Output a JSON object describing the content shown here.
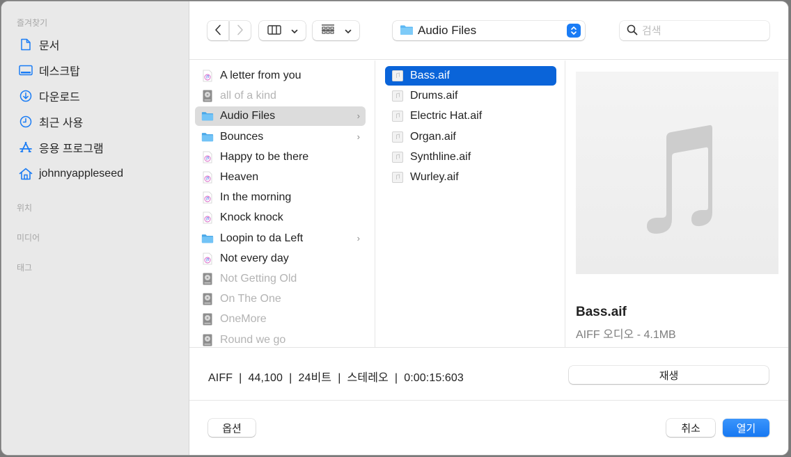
{
  "sidebar": {
    "favorites_label": "즐겨찾기",
    "favorites": [
      {
        "label": "문서",
        "icon": "document-icon"
      },
      {
        "label": "데스크탑",
        "icon": "desktop-icon"
      },
      {
        "label": "다운로드",
        "icon": "download-icon"
      },
      {
        "label": "최근 사용",
        "icon": "clock-icon"
      },
      {
        "label": "응용 프로그램",
        "icon": "applications-icon"
      },
      {
        "label": "johnnyappleseed",
        "icon": "home-icon"
      }
    ],
    "locations_label": "위치",
    "media_label": "미디어",
    "tags_label": "태그"
  },
  "toolbar": {
    "back_icon": "chevron-left-icon",
    "forward_icon": "chevron-right-icon",
    "view_mode_icon": "column-view-icon",
    "group_icon": "group-grid-icon",
    "location": "Audio Files",
    "search_placeholder": "검색"
  },
  "column1": {
    "items": [
      {
        "name": "A letter from you",
        "type": "audio",
        "dim": false
      },
      {
        "name": "all of a kind",
        "type": "project",
        "dim": true
      },
      {
        "name": "Audio Files",
        "type": "folder",
        "dim": false,
        "selected": true,
        "has_children": true
      },
      {
        "name": "Bounces",
        "type": "folder",
        "dim": false,
        "has_children": true
      },
      {
        "name": "Happy to be there",
        "type": "audio",
        "dim": false
      },
      {
        "name": "Heaven",
        "type": "audio",
        "dim": false
      },
      {
        "name": "In the morning",
        "type": "audio",
        "dim": false
      },
      {
        "name": "Knock knock",
        "type": "audio",
        "dim": false
      },
      {
        "name": "Loopin to da Left",
        "type": "folder",
        "dim": false,
        "has_children": true
      },
      {
        "name": "Not every day",
        "type": "audio",
        "dim": false
      },
      {
        "name": "Not Getting Old",
        "type": "project",
        "dim": true
      },
      {
        "name": "On The One",
        "type": "project",
        "dim": true
      },
      {
        "name": "OneMore",
        "type": "project",
        "dim": true
      },
      {
        "name": "Round we go",
        "type": "project",
        "dim": true
      }
    ]
  },
  "column2": {
    "items": [
      {
        "name": "Bass.aif",
        "selected": true
      },
      {
        "name": "Drums.aif"
      },
      {
        "name": "Electric Hat.aif"
      },
      {
        "name": "Organ.aif"
      },
      {
        "name": "Synthline.aif"
      },
      {
        "name": "Wurley.aif"
      }
    ]
  },
  "preview": {
    "icon": "music-note-icon",
    "name": "Bass.aif",
    "meta": "AIFF 오디오 - 4.1MB"
  },
  "infobar": {
    "text": "AIFF  |  44,100  |  24비트  |  스테레오  |  0:00:15:603",
    "play_label": "재생"
  },
  "footer": {
    "options_label": "옵션",
    "cancel_label": "취소",
    "open_label": "열기"
  },
  "colors": {
    "accent": "#1778f2",
    "selection": "#0a64d9",
    "sidebar_icon": "#1a7cf5",
    "folder": "#5cb8f4"
  }
}
